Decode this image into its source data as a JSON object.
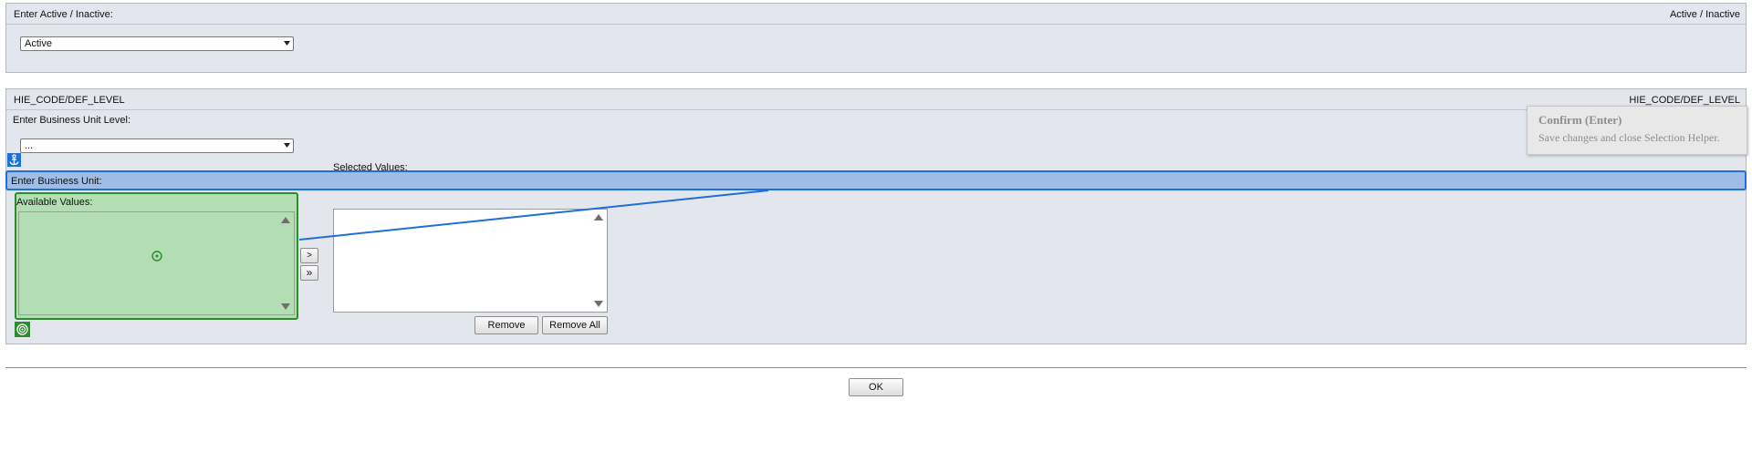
{
  "active_panel": {
    "title": "Enter Active / Inactive:",
    "title_right": "Active / Inactive",
    "select_value": "Active"
  },
  "hie_panel": {
    "title": "HIE_CODE/DEF_LEVEL",
    "title_right": "HIE_CODE/DEF_LEVEL",
    "bu_level_label": "Enter Business Unit Level:",
    "bu_level_value": "...",
    "bu_label": "Enter Business Unit:",
    "available_label": "Available Values:",
    "selected_label": "Selected Values:",
    "add_one_label": ">",
    "add_all_label": "»",
    "remove_label": "Remove",
    "remove_all_label": "Remove All"
  },
  "tooltip": {
    "title": "Confirm (Enter)",
    "description": "Save changes and close Selection Helper."
  },
  "footer": {
    "ok_label": "OK"
  },
  "overlay": {
    "highlight_color": "#1e6fd6",
    "target_color": "#2e8b2e",
    "anchor_icon": "anchor-icon",
    "target_icon": "target-icon"
  }
}
